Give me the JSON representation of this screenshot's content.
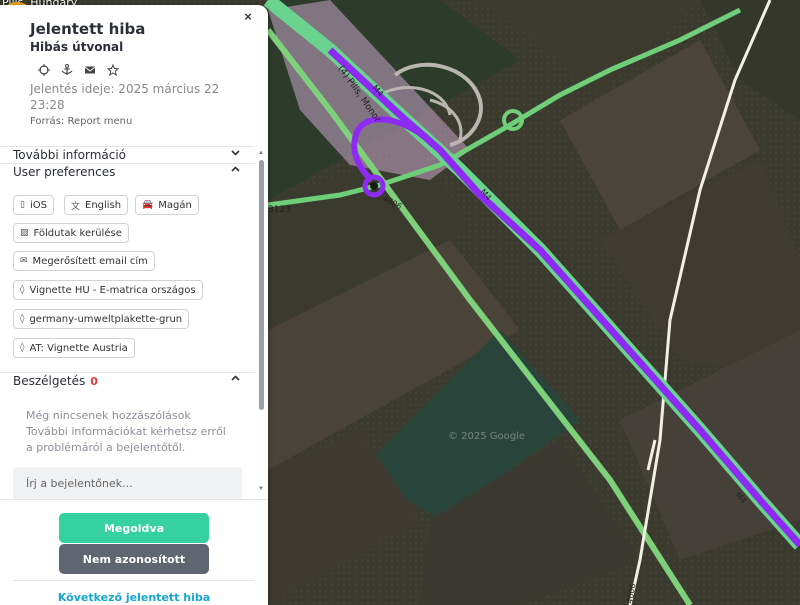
{
  "map": {
    "location_text": "Pilis, Hungary",
    "watermark": "© 2025 Google",
    "road_labels": [
      "(4) Pilis, Monor",
      "M4",
      "M4",
      "3123",
      "4606",
      "4606",
      "M4"
    ],
    "colors": {
      "route": "#8e2bf2",
      "highway": "#7fd07b",
      "road_green": "#6fcf79",
      "marker": "#f2a81a"
    }
  },
  "panel": {
    "title": "Jelentett hiba",
    "subtitle": "Hibás útvonal",
    "icons": [
      "crosshair-icon",
      "anchor-icon",
      "mail-icon",
      "star-icon"
    ],
    "report_time": "Jelentés ideje: 2025 március 22 23:28",
    "source": "Forrás: Report menu",
    "close_label": "×",
    "sections": {
      "more_info": "További információ",
      "user_preferences": "User preferences",
      "conversation": "Beszélgetés",
      "conversation_count": "0"
    },
    "chips": [
      {
        "icon": "phone-icon",
        "label": "iOS"
      },
      {
        "icon": "translate-icon",
        "label": "English"
      },
      {
        "icon": "car-icon",
        "label": "Magán"
      },
      {
        "icon": "dirt-road-icon",
        "label": "Földutak kerülése"
      },
      {
        "icon": "email-icon",
        "label": "Megerősített email cím"
      },
      {
        "icon": "tag-icon",
        "label": "Vignette HU - E-matrica országos"
      },
      {
        "icon": "tag-icon",
        "label": "germany-umweltplakette-grun"
      },
      {
        "icon": "tag-icon",
        "label": "AT: Vignette Austria"
      }
    ],
    "empty_conversation": "Még nincsenek hozzászólások További információkat kérhetsz erről a problémáról a bejelentőtől.",
    "comment_placeholder": "Írj a bejelentőnek...",
    "buttons": {
      "solved": "Megoldva",
      "not_identified": "Nem azonosított"
    },
    "next_link": "Következő jelentett hiba"
  }
}
